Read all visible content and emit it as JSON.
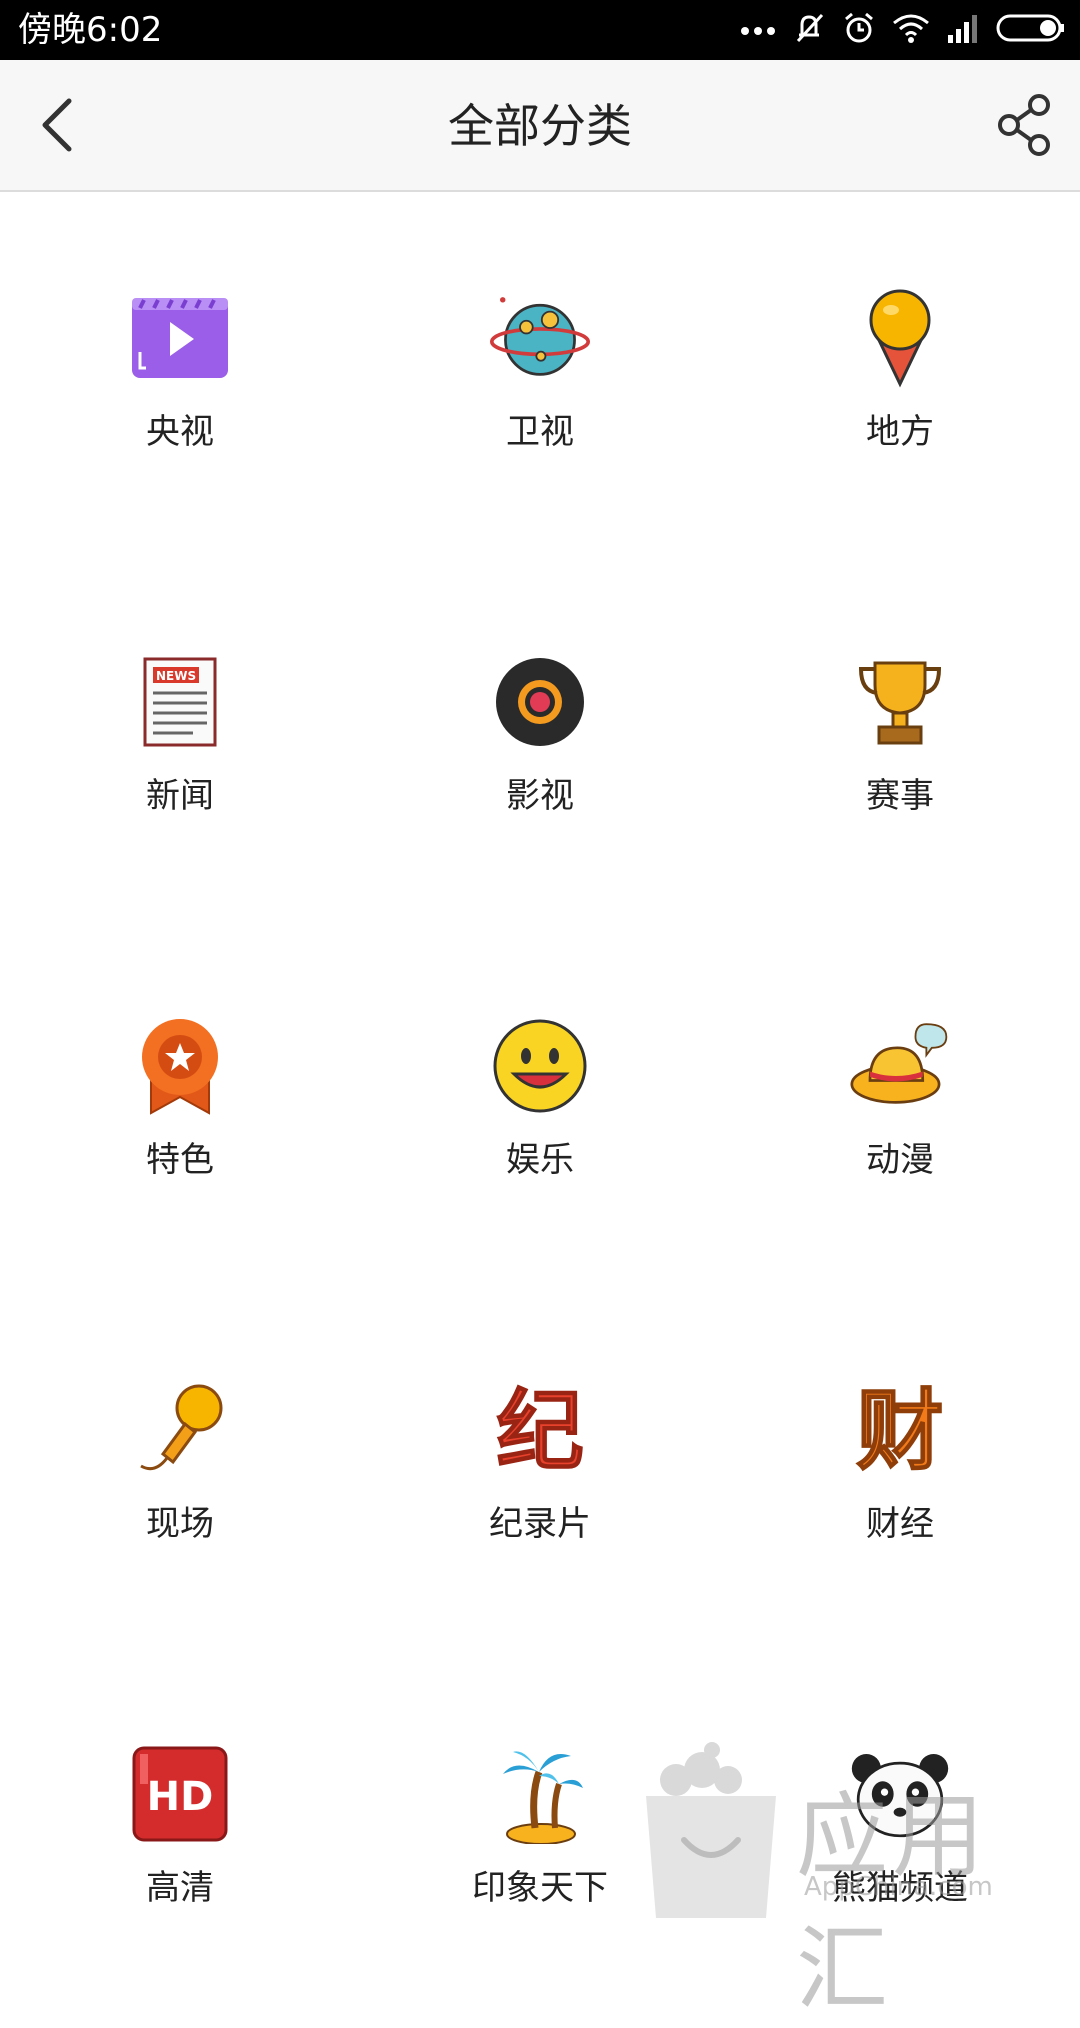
{
  "status_bar": {
    "time": "傍晚6:02",
    "icons": [
      "more-icon",
      "mute-icon",
      "alarm-icon",
      "wifi-icon",
      "signal-icon",
      "battery-icon"
    ]
  },
  "header": {
    "title": "全部分类",
    "back_icon": "back-arrow-icon",
    "share_icon": "share-icon"
  },
  "categories": [
    {
      "label": "央视",
      "icon": "video-play-icon"
    },
    {
      "label": "卫视",
      "icon": "planet-icon"
    },
    {
      "label": "地方",
      "icon": "map-pin-icon"
    },
    {
      "label": "新闻",
      "icon": "newspaper-icon"
    },
    {
      "label": "影视",
      "icon": "record-icon"
    },
    {
      "label": "赛事",
      "icon": "trophy-icon"
    },
    {
      "label": "特色",
      "icon": "star-badge-icon"
    },
    {
      "label": "娱乐",
      "icon": "smiley-icon"
    },
    {
      "label": "动漫",
      "icon": "straw-hat-icon"
    },
    {
      "label": "现场",
      "icon": "microphone-icon"
    },
    {
      "label": "纪录片",
      "icon": "ji-character-icon",
      "glyph": "纪"
    },
    {
      "label": "财经",
      "icon": "cai-character-icon",
      "glyph": "财"
    },
    {
      "label": "高清",
      "icon": "hd-icon",
      "glyph": "HD"
    },
    {
      "label": "印象天下",
      "icon": "palm-tree-icon"
    },
    {
      "label": "熊猫频道",
      "icon": "panda-icon"
    }
  ],
  "watermark": {
    "text": "应用汇",
    "url": "AppChina.com"
  }
}
